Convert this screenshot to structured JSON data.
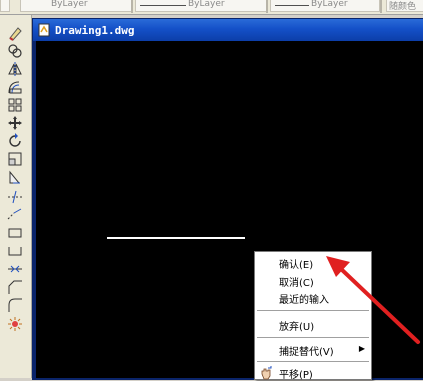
{
  "toolbar": {
    "layer_1": "ByLayer",
    "layer_2": "ByLayer",
    "layer_3": "ByLayer",
    "color_field": "随颜色"
  },
  "left_toolbar": {
    "tools": [
      {
        "icon": "erase-icon"
      },
      {
        "icon": "copy-icon"
      },
      {
        "icon": "mirror-icon"
      },
      {
        "icon": "offset-icon"
      },
      {
        "icon": "array-icon"
      },
      {
        "icon": "move-icon"
      },
      {
        "icon": "rotate-icon"
      },
      {
        "icon": "scale-icon"
      },
      {
        "icon": "stretch-icon"
      },
      {
        "icon": "trim-icon"
      },
      {
        "icon": "extend-icon"
      },
      {
        "icon": "break-point-icon"
      },
      {
        "icon": "break-icon"
      },
      {
        "icon": "join-icon"
      },
      {
        "icon": "chamfer-icon"
      },
      {
        "icon": "fillet-icon"
      },
      {
        "icon": "explode-icon"
      }
    ]
  },
  "window": {
    "title": "Drawing1.dwg"
  },
  "context_menu": {
    "confirm": "确认(E)",
    "cancel": "取消(C)",
    "recent_input": "最近的输入",
    "discard": "放弃(U)",
    "snap_override": "捕捉替代(V)",
    "pan": "平移(P)"
  },
  "colors": {
    "canvas": "#000000",
    "annotation_arrow": "#e02020",
    "titlebar": "#1450c8"
  }
}
